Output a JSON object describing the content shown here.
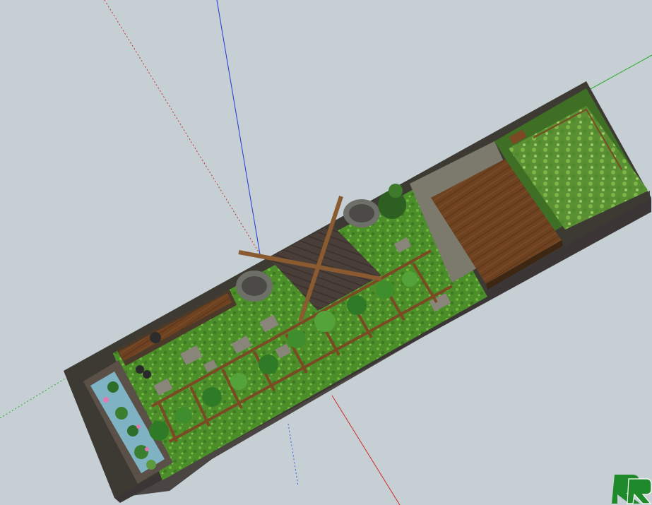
{
  "viewport": {
    "background": "#c6cfd3",
    "axes": {
      "red_axis": "#d03030",
      "green_axis": "#30b030",
      "blue_axis": "#2040d0"
    }
  },
  "model": {
    "sign_text": "",
    "components": [
      "pond",
      "planters",
      "stepping-stones",
      "timber-pergola",
      "pavilion-roof",
      "timber-deck",
      "vegetable-bed",
      "walls"
    ]
  },
  "watermark": {
    "icon": "logo-icon"
  }
}
